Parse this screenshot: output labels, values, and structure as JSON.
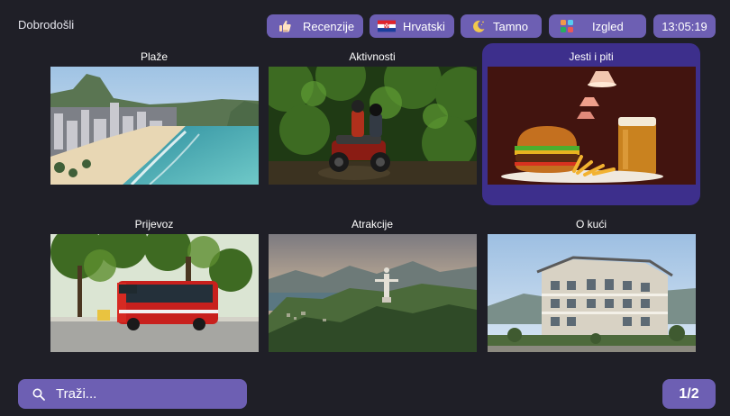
{
  "header": {
    "greeting": "Dobrodošli",
    "reviews_label": "Recenzije",
    "language_label": "Hrvatski",
    "theme_label": "Tamno",
    "layout_label": "Izgled",
    "time": "13:05:19",
    "icons": {
      "reviews": "thumbs-up-icon",
      "language": "croatia-flag-icon",
      "theme": "moon-icon",
      "layout": "grid-icon"
    }
  },
  "tiles": [
    {
      "title": "Plaže",
      "image": "beach-city-photo"
    },
    {
      "title": "Aktivnosti",
      "image": "atv-forest-photo"
    },
    {
      "title": "Jesti i piti",
      "image": "burger-beer-photo",
      "selected": true
    },
    {
      "title": "Prijevoz",
      "image": "red-bus-photo"
    },
    {
      "title": "Atrakcije",
      "image": "mountain-statue-photo"
    },
    {
      "title": "O kući",
      "image": "hotel-building-photo"
    }
  ],
  "search": {
    "label": "Traži...",
    "icon": "search-icon"
  },
  "pager": {
    "label": "1/2"
  },
  "colors": {
    "background": "#1f1f27",
    "accent": "#6d5fb3",
    "selected_tile": "#3d2f8c"
  }
}
